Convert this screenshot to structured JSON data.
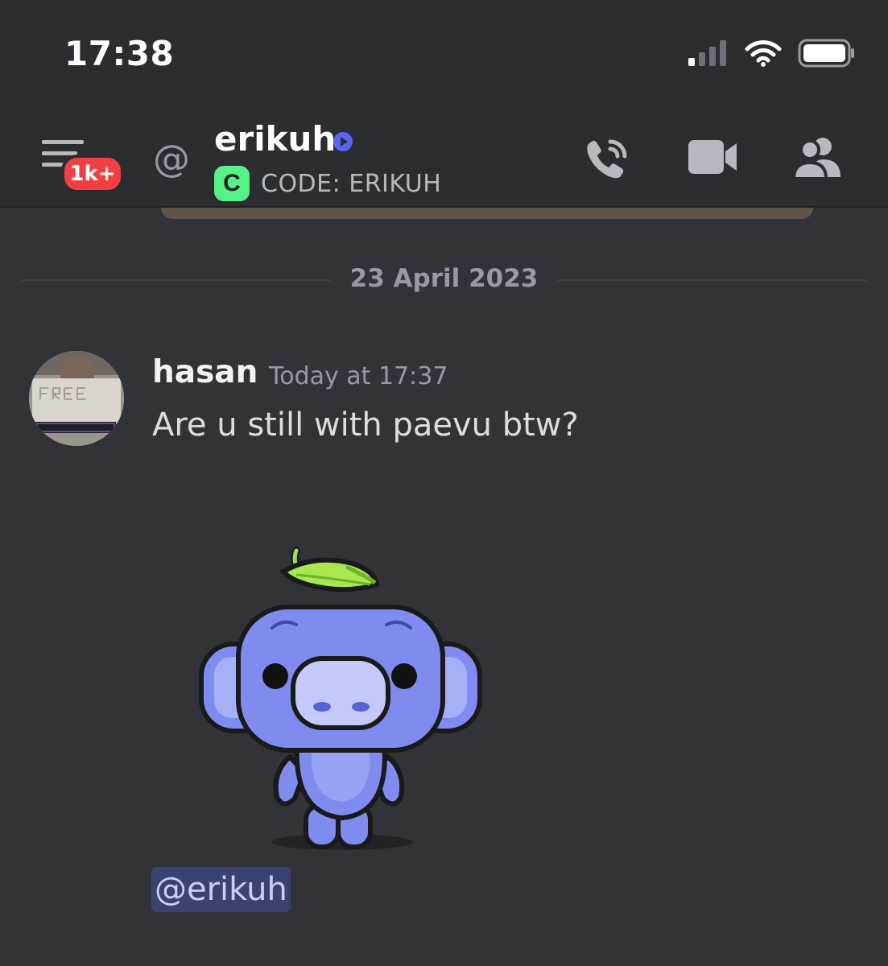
{
  "status_bar": {
    "time": "17:38"
  },
  "header": {
    "badge": "1k+",
    "at_symbol": "@",
    "title": "erikuh",
    "status_logo": "C",
    "status_text": "CODE: ERIKUH",
    "icons": [
      "menu-icon",
      "at-icon",
      "call-icon",
      "video-icon",
      "members-icon"
    ]
  },
  "date_divider": "23 April 2023",
  "message": {
    "username": "hasan",
    "timestamp": "Today at 17:37",
    "text": "Are u still with paevu btw?",
    "mention": "@erikuh",
    "sticker": "wumpus-leaf-sticker"
  },
  "colors": {
    "background": "#313338",
    "header": "#2b2d31",
    "mention_bg": "#3c4270",
    "badge": "#f23f43",
    "accent": "#5865f2",
    "status_logo": "#57f287"
  }
}
